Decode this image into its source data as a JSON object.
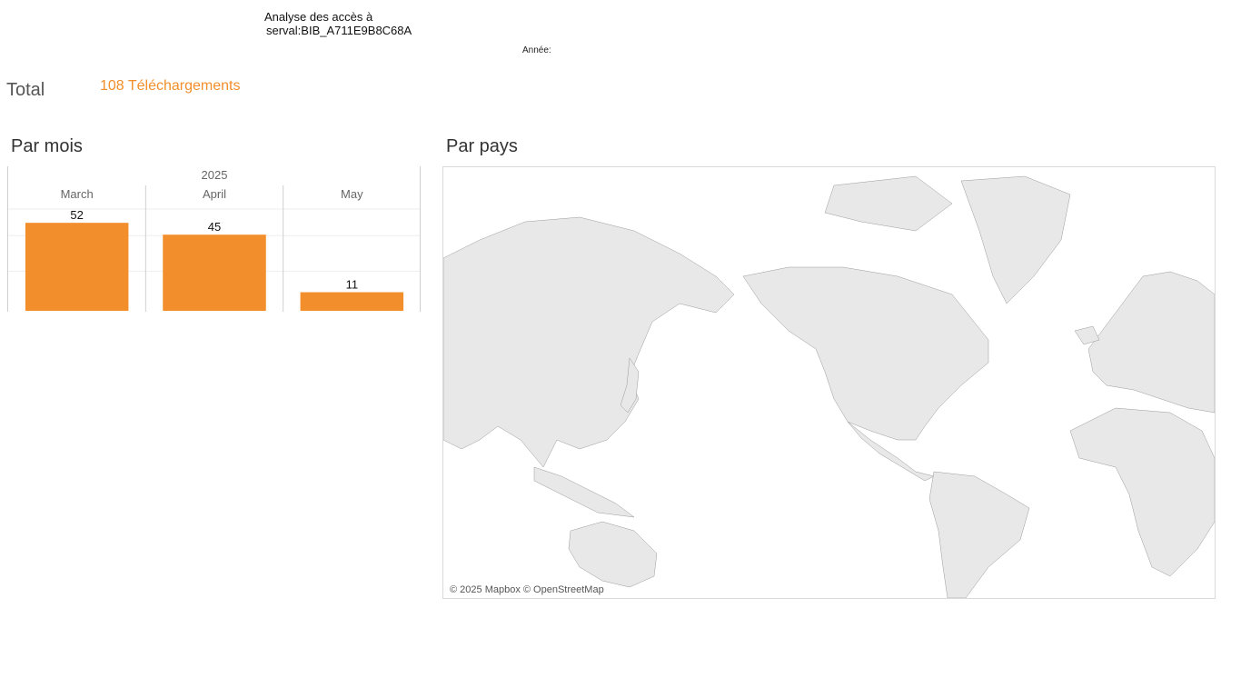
{
  "header": {
    "title_line1": "Analyse des accès à",
    "title_line2": "serval:BIB_A711E9B8C68A",
    "year_filter_label": "Année:"
  },
  "summary": {
    "total_label": "Total",
    "total_value": "108 Téléchargements"
  },
  "sections": {
    "by_month_title": "Par mois",
    "by_country_title": "Par pays"
  },
  "map": {
    "credit": "© 2025 Mapbox © OpenStreetMap",
    "land_color": "#e8e8e8",
    "border_color": "#777777"
  },
  "chart_data": {
    "type": "bar",
    "group_label": "2025",
    "categories": [
      "March",
      "April",
      "May"
    ],
    "values": [
      52,
      45,
      11
    ],
    "data_labels": [
      "52",
      "45",
      "11"
    ],
    "ylim": [
      0,
      58
    ],
    "bar_color": "#f28e2b",
    "grid": true
  }
}
